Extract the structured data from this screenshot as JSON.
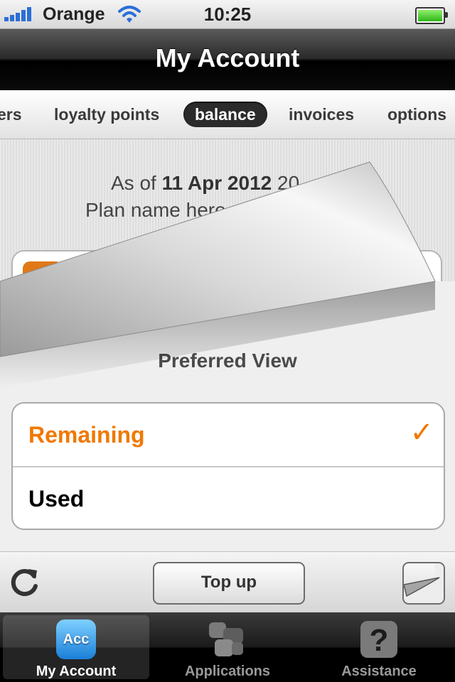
{
  "status_bar": {
    "carrier": "Orange",
    "time": "10:25"
  },
  "nav": {
    "title": "My Account"
  },
  "segments": [
    {
      "label": "ers",
      "active": false
    },
    {
      "label": "loyalty points",
      "active": false
    },
    {
      "label": "balance",
      "active": true
    },
    {
      "label": "invoices",
      "active": false
    },
    {
      "label": "options",
      "active": false
    }
  ],
  "balance": {
    "as_of_prefix": "As of",
    "as_of_date": "11 Apr 2012",
    "as_of_suffix": "20",
    "plan_name": "Plan name here"
  },
  "preferred_view": {
    "title": "Preferred View",
    "options": [
      {
        "label": "Remaining",
        "selected": true
      },
      {
        "label": "Used",
        "selected": false
      }
    ],
    "check_glyph": "✓"
  },
  "toolbar": {
    "top_up_label": "Top up"
  },
  "tabbar": {
    "tabs": [
      {
        "label": "My Account",
        "icon": "acc-icon",
        "icon_text": "Acc",
        "active": true
      },
      {
        "label": "Applications",
        "icon": "applications-icon",
        "active": false
      },
      {
        "label": "Assistance",
        "icon": "help-icon",
        "active": false
      }
    ]
  },
  "colors": {
    "accent_orange": "#f07800",
    "tab_active_blue": "#2a8ae0"
  }
}
